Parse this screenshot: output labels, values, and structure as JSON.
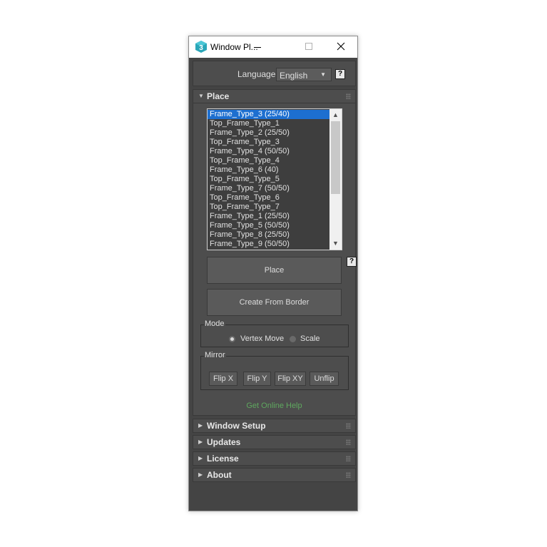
{
  "window": {
    "title": "Window Pl...",
    "app_icon_letter": "3"
  },
  "language": {
    "label": "Language:",
    "value": "English",
    "help": "?"
  },
  "rollouts": {
    "place": "Place",
    "window_setup": "Window Setup",
    "updates": "Updates",
    "license": "License",
    "about": "About"
  },
  "frame_list": {
    "selected_index": 0,
    "items": [
      "Frame_Type_3 (25/40)",
      "Top_Frame_Type_1",
      "Frame_Type_2 (25/50)",
      "Top_Frame_Type_3",
      "Frame_Type_4 (50/50)",
      "Top_Frame_Type_4",
      "Frame_Type_6 (40)",
      "Top_Frame_Type_5",
      "Frame_Type_7 (50/50)",
      "Top_Frame_Type_6",
      "Top_Frame_Type_7",
      "Frame_Type_1 (25/50)",
      "Frame_Type_5 (50/50)",
      "Frame_Type_8 (25/50)",
      "Frame_Type_9 (50/50)"
    ]
  },
  "place": {
    "help": "?",
    "place_button": "Place",
    "create_from_border_button": "Create From Border",
    "online_help": "Get Online Help"
  },
  "mode": {
    "label": "Mode",
    "vertex_move": "Vertex Move",
    "scale": "Scale",
    "selected": "vertex_move"
  },
  "mirror": {
    "label": "Mirror",
    "flip_x": "Flip X",
    "flip_y": "Flip Y",
    "flip_xy": "Flip XY",
    "unflip": "Unflip"
  },
  "colors": {
    "panel_bg": "#4d4d4d",
    "selection": "#1d6fd0",
    "help_link": "#5fa85f",
    "app_icon": "#2aa6b8"
  }
}
